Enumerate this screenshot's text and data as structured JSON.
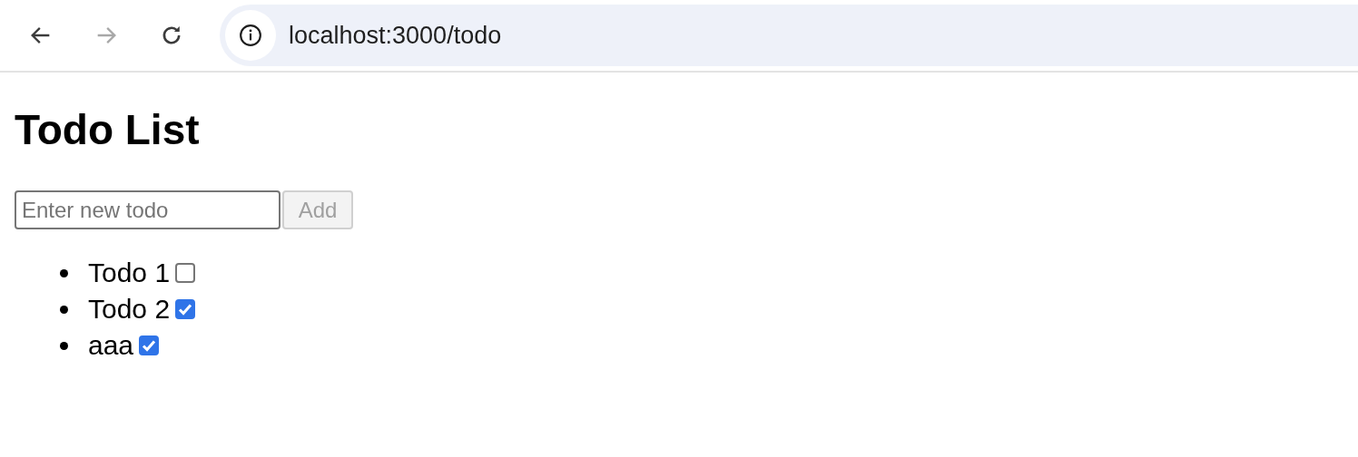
{
  "browser": {
    "back_disabled": false,
    "forward_disabled": true,
    "url": "localhost:3000/todo"
  },
  "page": {
    "title": "Todo List",
    "input": {
      "placeholder": "Enter new todo"
    },
    "add_button": {
      "label": "Add",
      "disabled": true
    },
    "todos": [
      {
        "text": "Todo 1",
        "checked": false
      },
      {
        "text": "Todo 2",
        "checked": true
      },
      {
        "text": "aaa",
        "checked": true
      }
    ]
  }
}
